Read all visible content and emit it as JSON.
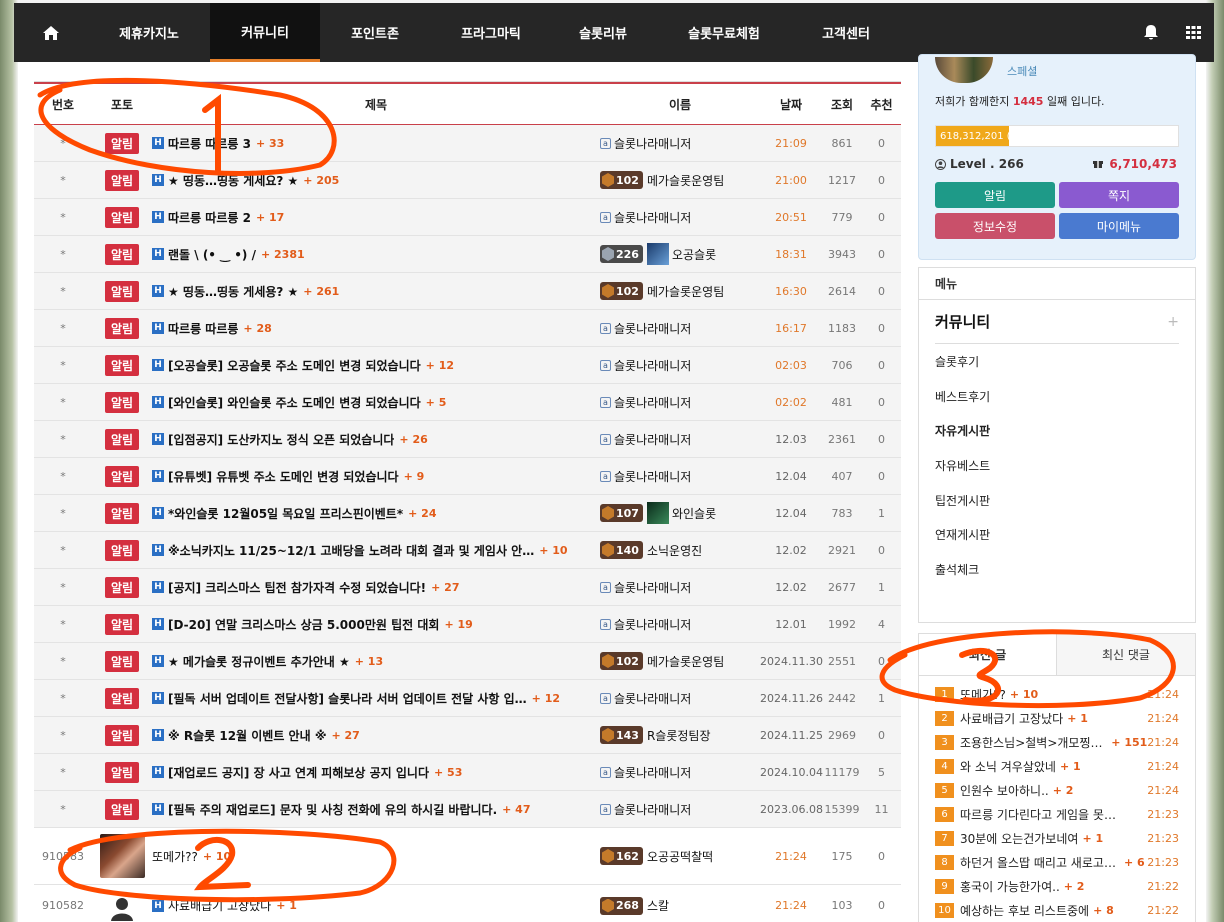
{
  "nav": {
    "items": [
      {
        "label": "제휴카지노",
        "active": false
      },
      {
        "label": "커뮤니티",
        "active": true
      },
      {
        "label": "포인트존",
        "active": false
      },
      {
        "label": "프라그마틱",
        "active": false
      },
      {
        "label": "슬롯리뷰",
        "active": false
      },
      {
        "label": "슬롯무료체험",
        "active": false
      },
      {
        "label": "고객센터",
        "active": false
      }
    ],
    "icons": [
      "home-icon",
      "bell-icon",
      "grid-icon"
    ]
  },
  "board": {
    "headers": {
      "no": "번호",
      "photo": "포토",
      "title": "제목",
      "name": "이름",
      "date": "날짜",
      "views": "조회",
      "rec": "추천"
    },
    "notice_badge": "알림",
    "notice_no": "*",
    "notices": [
      {
        "title": "따르릉 따르릉 3",
        "cnt": "+ 33",
        "name": "슬롯나라매니저",
        "level": "",
        "date": "21:09",
        "views": "861",
        "rec": "0"
      },
      {
        "title": "★ 띵동…띵동 게세요? ★",
        "cnt": "+ 205",
        "name": "메가슬롯운영팀",
        "level": "102",
        "date": "21:00",
        "views": "1217",
        "rec": "0"
      },
      {
        "title": "따르릉 따르릉 2",
        "cnt": "+ 17",
        "name": "슬롯나라매니저",
        "level": "",
        "date": "20:51",
        "views": "779",
        "rec": "0"
      },
      {
        "title": "랜돌 \\ (• ‿ •) /",
        "cnt": "+ 2381",
        "name": "오공슬롯",
        "level": "226",
        "date": "18:31",
        "views": "3943",
        "rec": "0"
      },
      {
        "title": "★ 띵동…띵동 게세용? ★",
        "cnt": "+ 261",
        "name": "메가슬롯운영팀",
        "level": "102",
        "date": "16:30",
        "views": "2614",
        "rec": "0"
      },
      {
        "title": "따르릉 따르릉",
        "cnt": "+ 28",
        "name": "슬롯나라매니저",
        "level": "",
        "date": "16:17",
        "views": "1183",
        "rec": "0"
      },
      {
        "title": "[오공슬롯] 오공슬롯 주소 도메인 변경 되었습니다",
        "cnt": "+ 12",
        "name": "슬롯나라매니저",
        "level": "",
        "date": "02:03",
        "views": "706",
        "rec": "0"
      },
      {
        "title": "[와인슬롯] 와인슬롯 주소 도메인 변경 되었습니다",
        "cnt": "+ 5",
        "name": "슬롯나라매니저",
        "level": "",
        "date": "02:02",
        "views": "481",
        "rec": "0"
      },
      {
        "title": "[입점공지] 도산카지노 정식 오픈 되었습니다",
        "cnt": "+ 26",
        "name": "슬롯나라매니저",
        "level": "",
        "date": "12.03",
        "views": "2361",
        "rec": "0"
      },
      {
        "title": "[유튜벳] 유튜벳 주소 도메인 변경 되었습니다",
        "cnt": "+ 9",
        "name": "슬롯나라매니저",
        "level": "",
        "date": "12.04",
        "views": "407",
        "rec": "0"
      },
      {
        "title": "*와인슬롯 12월05일 목요일 프리스핀이벤트*",
        "cnt": "+ 24",
        "name": "와인슬롯",
        "level": "107",
        "date": "12.04",
        "views": "783",
        "rec": "1"
      },
      {
        "title": "※소닉카지노 11/25~12/1 고배당을 노려라 대회 결과 및 게임사 안…",
        "cnt": "+ 10",
        "name": "소닉운영진",
        "level": "140",
        "date": "12.02",
        "views": "2921",
        "rec": "0"
      },
      {
        "title": "[공지] 크리스마스 팁전 참가자격 수정 되었습니다!",
        "cnt": "+ 27",
        "name": "슬롯나라매니저",
        "level": "",
        "date": "12.02",
        "views": "2677",
        "rec": "1"
      },
      {
        "title": "[D-20] 연말 크리스마스 상금 5.000만원 팁전 대회",
        "cnt": "+ 19",
        "name": "슬롯나라매니저",
        "level": "",
        "date": "12.01",
        "views": "1992",
        "rec": "4"
      },
      {
        "title": "★ 메가슬롯 정규이벤트 추가안내 ★",
        "cnt": "+ 13",
        "name": "메가슬롯운영팀",
        "level": "102",
        "date": "2024.11.30",
        "views": "2551",
        "rec": "0"
      },
      {
        "title": "[필독 서버 업데이트 전달사항] 슬롯나라 서버 업데이트 전달 사항 입…",
        "cnt": "+ 12",
        "name": "슬롯나라매니저",
        "level": "",
        "date": "2024.11.26",
        "views": "2442",
        "rec": "1"
      },
      {
        "title": "※ R슬롯 12월 이벤트 안내 ※",
        "cnt": "+ 27",
        "name": "R슬롯정팀장",
        "level": "143",
        "date": "2024.11.25",
        "views": "2969",
        "rec": "0"
      },
      {
        "title": "[재업로드 공지] 장 사고 연계 피해보상 공지 입니다",
        "cnt": "+ 53",
        "name": "슬롯나라매니저",
        "level": "",
        "date": "2024.10.04",
        "views": "11179",
        "rec": "5"
      },
      {
        "title": "[필독 주의 재업로드] 문자 및 사칭 전화에 유의 하시길 바랍니다.",
        "cnt": "+ 47",
        "name": "슬롯나라매니저",
        "level": "",
        "date": "2023.06.08",
        "views": "15399",
        "rec": "11"
      }
    ],
    "posts": [
      {
        "no": "910583",
        "title": "또메가??",
        "cnt": "+ 10",
        "name": "오공공떡찰떡",
        "level": "162",
        "date": "21:24",
        "views": "175",
        "rec": "0"
      },
      {
        "no": "910582",
        "title": "사료배급기 고장났다",
        "cnt": "+ 1",
        "name": "스칼",
        "level": "268",
        "date": "21:24",
        "views": "103",
        "rec": "0"
      }
    ]
  },
  "profile": {
    "grade": "스페셜",
    "days_prefix": "저희가 함께한지 ",
    "days": "1445",
    "days_suffix": " 일째 입니다.",
    "exp_text": "618,312,201 (30%)",
    "exp_fraction": 0.3,
    "level": "Level . 266",
    "points": "6,710,473",
    "buttons": {
      "notify": "알림",
      "memo": "쪽지",
      "edit": "정보수정",
      "mymenu": "마이메뉴"
    }
  },
  "menu": {
    "head": "메뉴",
    "category": "커뮤니티",
    "plus": "+",
    "items": [
      "슬롯후기",
      "베스트후기",
      "자유게시판",
      "자유베스트",
      "팁전게시판",
      "연재게시판",
      "출석체크"
    ]
  },
  "latest": {
    "tabs": [
      "최신 글",
      "최신 댓글"
    ],
    "items": [
      {
        "n": "1",
        "title": "또메가??",
        "cnt": "+ 10",
        "time": "21:24"
      },
      {
        "n": "2",
        "title": "사료배급기 고장났다",
        "cnt": "+ 1",
        "time": "21:24"
      },
      {
        "n": "3",
        "title": "조용한스님>철벽>개모찡>바…",
        "cnt": "+ 151",
        "time": "21:24"
      },
      {
        "n": "4",
        "title": "와 소닉 겨우살았네",
        "cnt": "+ 1",
        "time": "21:24"
      },
      {
        "n": "5",
        "title": "인원수 보아하니..",
        "cnt": "+ 2",
        "time": "21:24"
      },
      {
        "n": "6",
        "title": "따르릉 기다린다고 게임을 못하겠네",
        "cnt": "",
        "time": "21:23"
      },
      {
        "n": "7",
        "title": "30분에 오는건가보네여",
        "cnt": "+ 1",
        "time": "21:23"
      },
      {
        "n": "8",
        "title": "하던거 올스땁 때리고 새로고침…",
        "cnt": "+ 6",
        "time": "21:23"
      },
      {
        "n": "9",
        "title": "홍국이 가능한가여..",
        "cnt": "+ 2",
        "time": "21:22"
      },
      {
        "n": "10",
        "title": "예상하는 후보 리스트중에",
        "cnt": "+ 8",
        "time": "21:22"
      }
    ]
  },
  "annotations": {
    "labels": [
      "1",
      "2",
      "3"
    ],
    "color": "#ff4a00"
  }
}
